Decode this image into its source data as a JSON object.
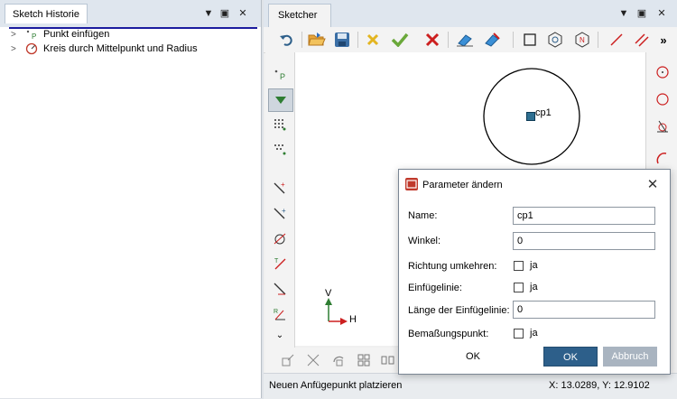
{
  "left_panel": {
    "tab_title": "Sketch Historie",
    "items": [
      {
        "label": "Punkt einfügen",
        "icon": "point-insert-icon"
      },
      {
        "label": "Kreis durch Mittelpunkt und Radius",
        "icon": "circle-center-radius-icon"
      }
    ]
  },
  "right_panel": {
    "tab_title": "Sketcher",
    "more_label": "»",
    "canvas": {
      "point_label": "cp1",
      "axis_v_label": "V",
      "axis_h_label": "H"
    },
    "status_left": "Neuen Anfügepunkt platzieren",
    "status_right": "X: 13.0289, Y: 12.9102"
  },
  "dialog": {
    "title": "Parameter ändern",
    "fields": {
      "name_label": "Name:",
      "name_value": "cp1",
      "winkel_label": "Winkel:",
      "winkel_value": "0",
      "richtung_label": "Richtung umkehren:",
      "richtung_check_label": "ja",
      "einfuege_label": "Einfügelinie:",
      "einfuege_check_label": "ja",
      "laenge_label": "Länge der Einfügelinie:",
      "laenge_value": "0",
      "bemassung_label": "Bemaßungspunkt:",
      "bemassung_check_label": "ja"
    },
    "ok_plain_label": "OK",
    "ok_label": "OK",
    "abbruch_label": "Abbruch"
  },
  "colors": {
    "accent_blue": "#2d5f8a",
    "disabled_button": "#a9b4c0",
    "tree_underline": "#1b1b9e"
  }
}
